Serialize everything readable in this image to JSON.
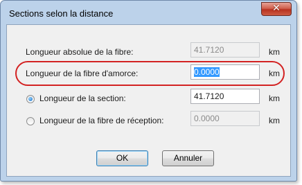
{
  "dialog": {
    "title": "Sections selon la distance",
    "close_icon": "close-icon"
  },
  "rows": {
    "absolute": {
      "label": "Longueur absolue de la fibre:",
      "value": "41.7120",
      "unit": "km"
    },
    "launch": {
      "label": "Longueur de la fibre d'amorce:",
      "value": "0.0000",
      "unit": "km"
    },
    "section": {
      "label": "Longueur de la section:",
      "value": "41.7120",
      "unit": "km",
      "selected": true
    },
    "receive": {
      "label": "Longueur de la fibre de réception:",
      "value": "0.0000",
      "unit": "km",
      "selected": false
    }
  },
  "buttons": {
    "ok": "OK",
    "cancel": "Annuler"
  },
  "colors": {
    "highlight": "#d32222",
    "selection": "#3399ff"
  }
}
